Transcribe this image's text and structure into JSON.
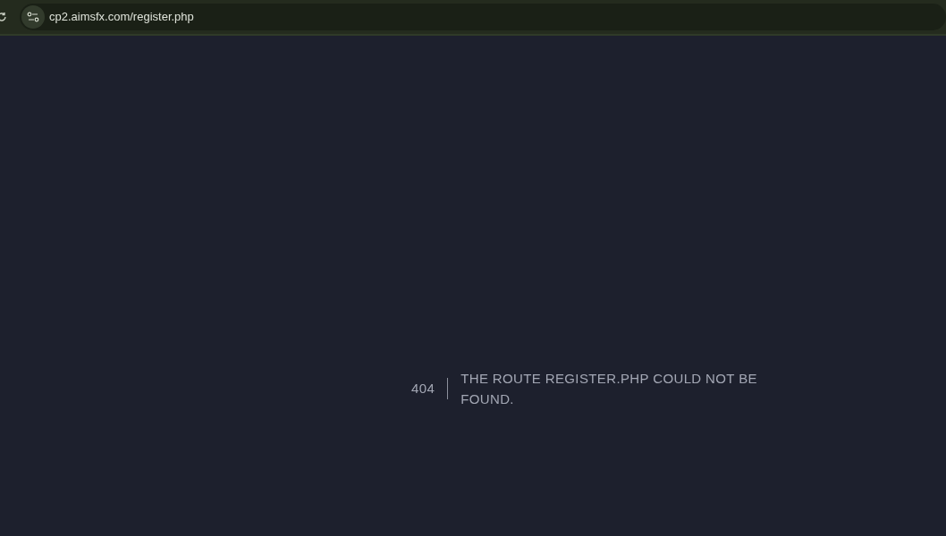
{
  "browser": {
    "url": "cp2.aimsfx.com/register.php"
  },
  "error": {
    "code": "404",
    "message": "THE ROUTE REGISTER.PHP COULD NOT BE FOUND."
  }
}
